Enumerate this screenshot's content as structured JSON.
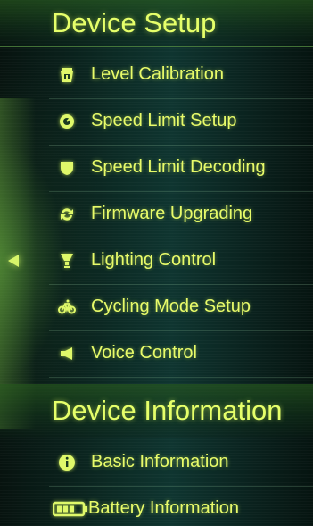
{
  "sections": [
    {
      "title": "Device Setup",
      "items": [
        {
          "label": "Level Calibration",
          "icon": "level-calibration-icon"
        },
        {
          "label": "Speed Limit Setup",
          "icon": "speed-limit-icon"
        },
        {
          "label": "Speed Limit Decoding",
          "icon": "shield-icon"
        },
        {
          "label": "Firmware Upgrading",
          "icon": "refresh-icon"
        },
        {
          "label": "Lighting Control",
          "icon": "lamp-icon"
        },
        {
          "label": "Cycling Mode Setup",
          "icon": "bicycle-icon"
        },
        {
          "label": "Voice Control",
          "icon": "megaphone-icon"
        }
      ]
    },
    {
      "title": "Device Information",
      "items": [
        {
          "label": "Basic Information",
          "icon": "info-icon"
        },
        {
          "label": "Battery Information",
          "icon": "battery-icon"
        }
      ]
    }
  ],
  "nav": {
    "back_icon": "back-arrow-icon"
  },
  "colors": {
    "accent": "#e6ff6a",
    "background": "#0c2a24"
  }
}
